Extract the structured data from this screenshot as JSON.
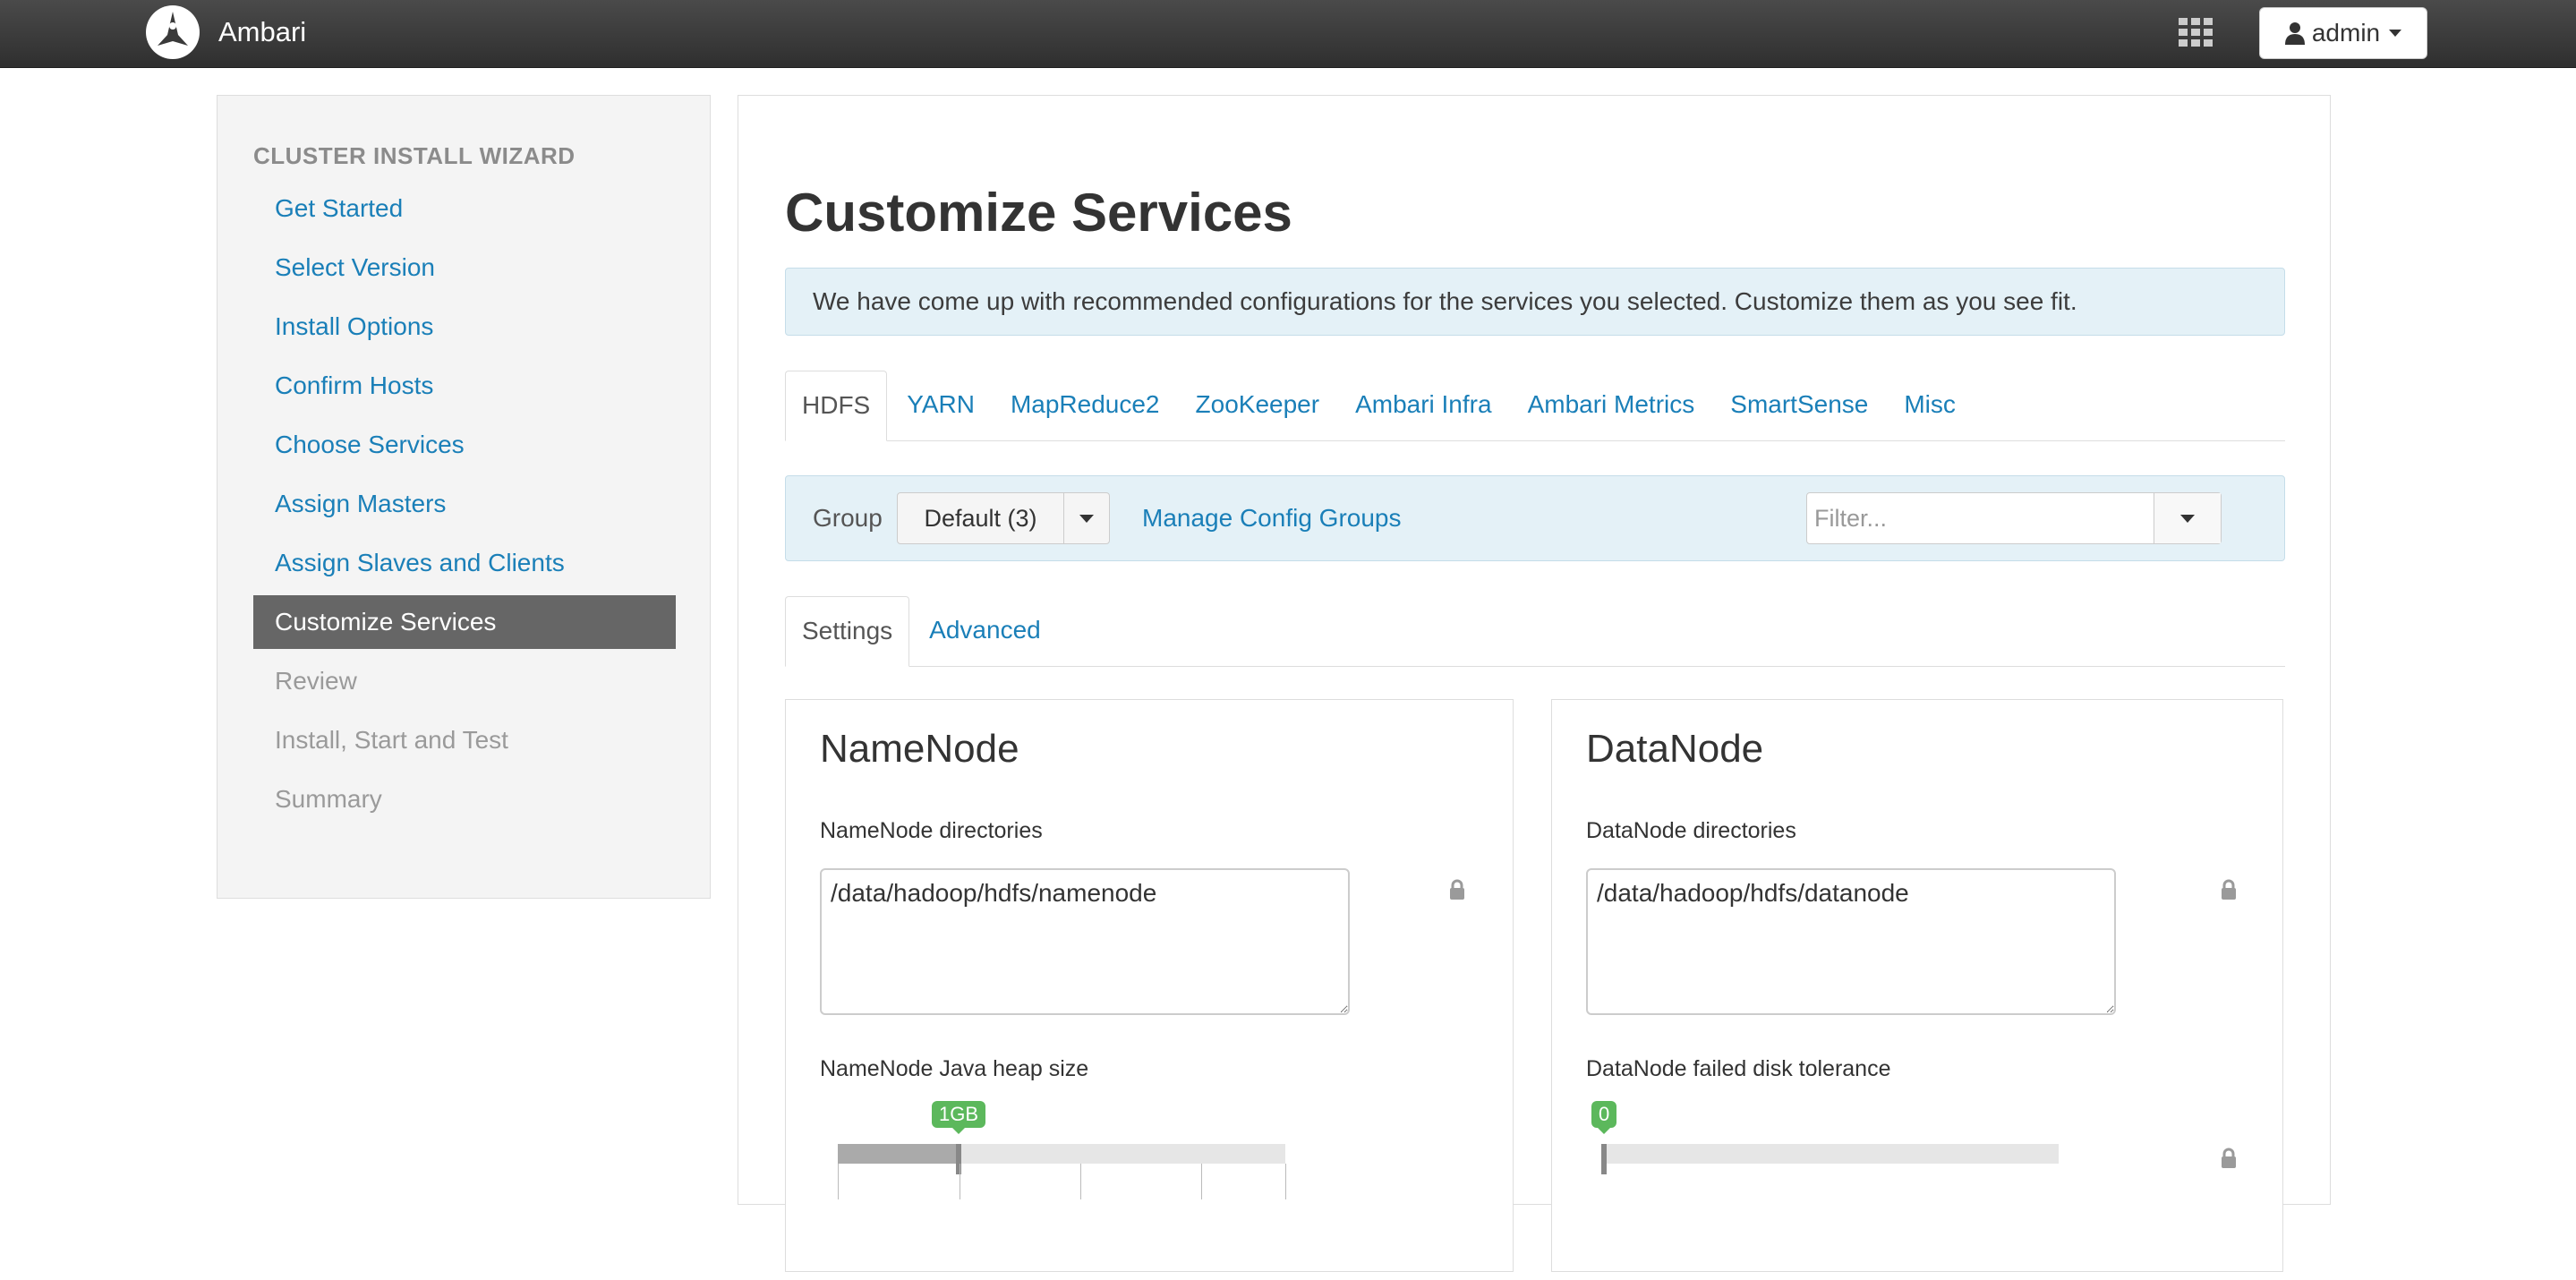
{
  "header": {
    "app_name": "Ambari",
    "logo_icon": "ambari-logo-icon",
    "apps_icon": "grid-apps-icon",
    "user_label": "admin"
  },
  "sidebar": {
    "title": "CLUSTER INSTALL WIZARD",
    "steps": [
      {
        "label": "Get Started",
        "state": "link"
      },
      {
        "label": "Select Version",
        "state": "link"
      },
      {
        "label": "Install Options",
        "state": "link"
      },
      {
        "label": "Confirm Hosts",
        "state": "link"
      },
      {
        "label": "Choose Services",
        "state": "link"
      },
      {
        "label": "Assign Masters",
        "state": "link"
      },
      {
        "label": "Assign Slaves and Clients",
        "state": "link"
      },
      {
        "label": "Customize Services",
        "state": "active"
      },
      {
        "label": "Review",
        "state": "disabled"
      },
      {
        "label": "Install, Start and Test",
        "state": "disabled"
      },
      {
        "label": "Summary",
        "state": "disabled"
      }
    ]
  },
  "main": {
    "title": "Customize Services",
    "alert": "We have come up with recommended configurations for the services you selected. Customize them as you see fit.",
    "service_tabs": [
      "HDFS",
      "YARN",
      "MapReduce2",
      "ZooKeeper",
      "Ambari Infra",
      "Ambari Metrics",
      "SmartSense",
      "Misc"
    ],
    "active_service_tab": "HDFS",
    "group_bar": {
      "label": "Group",
      "selected_group": "Default (3)",
      "manage_link": "Manage Config Groups",
      "filter_placeholder": "Filter..."
    },
    "sub_tabs": [
      "Settings",
      "Advanced"
    ],
    "active_sub_tab": "Settings",
    "namenode": {
      "title": "NameNode",
      "dir_label": "NameNode directories",
      "dir_value": "/data/hadoop/hdfs/namenode",
      "heap_label": "NameNode Java heap size",
      "heap_value": "1GB",
      "heap_fraction": 0.27
    },
    "datanode": {
      "title": "DataNode",
      "dir_label": "DataNode directories",
      "dir_value": "/data/hadoop/hdfs/datanode",
      "tolerance_label": "DataNode failed disk tolerance",
      "tolerance_value": "0",
      "tolerance_fraction": 0.0
    }
  },
  "colors": {
    "link": "#1a7fb8",
    "active_step_bg": "#666666",
    "alert_bg": "#e4f1f7",
    "badge_green": "#5cb85c"
  }
}
